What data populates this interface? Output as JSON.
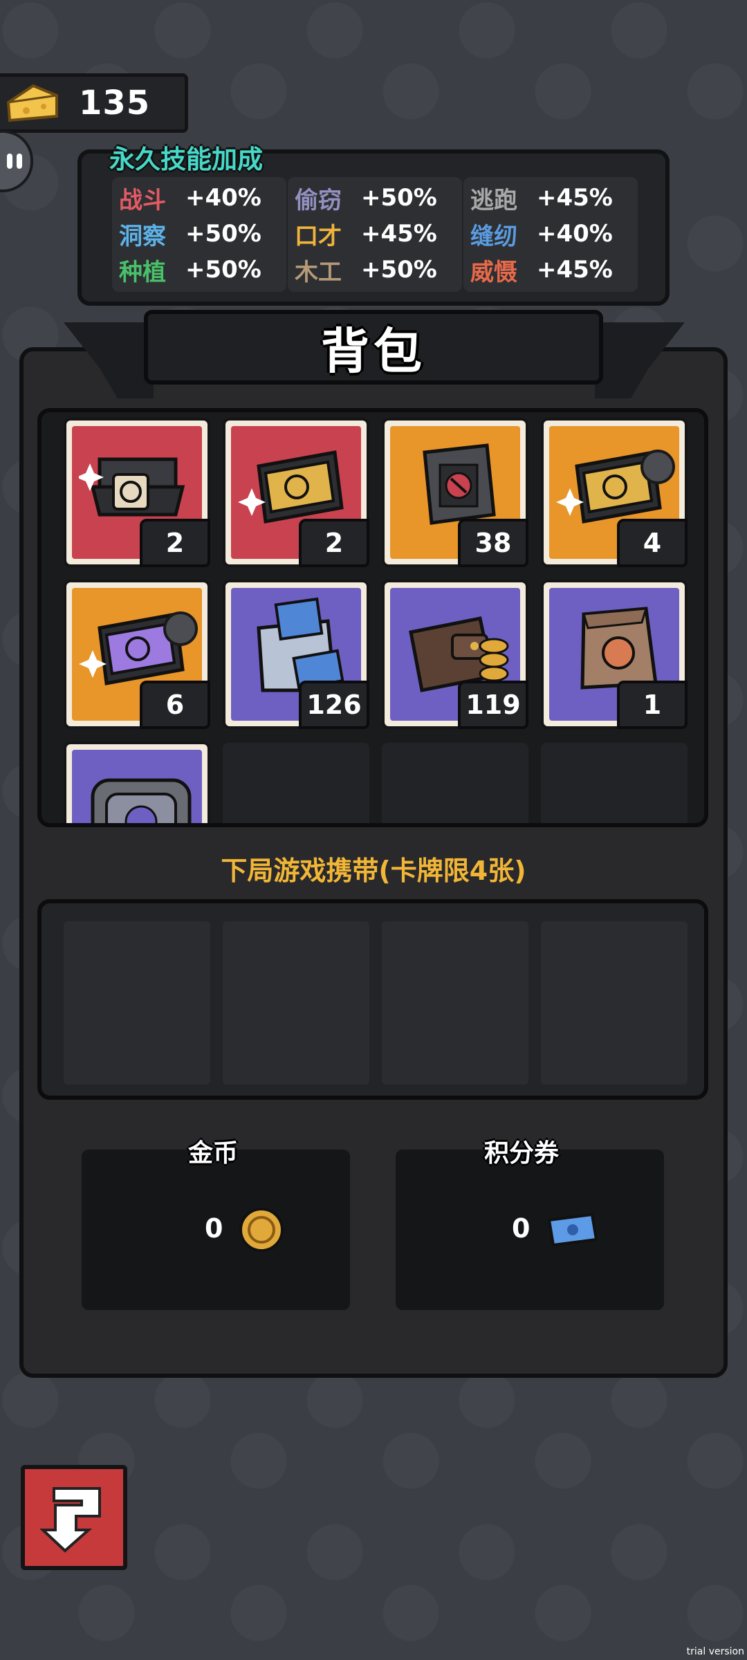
{
  "header": {
    "cheese_count": "135"
  },
  "skills": {
    "title": "永久技能加成",
    "columns": [
      [
        {
          "name": "战斗",
          "value": "+40%",
          "color": "#e35b64"
        },
        {
          "name": "洞察",
          "value": "+50%",
          "color": "#5db2e8"
        },
        {
          "name": "种植",
          "value": "+50%",
          "color": "#49c06a"
        }
      ],
      [
        {
          "name": "偷窃",
          "value": "+50%",
          "color": "#9490c0"
        },
        {
          "name": "口才",
          "value": "+45%",
          "color": "#f0b43c"
        },
        {
          "name": "木工",
          "value": "+50%",
          "color": "#b59a78"
        }
      ],
      [
        {
          "name": "逃跑",
          "value": "+45%",
          "color": "#a9a9a9"
        },
        {
          "name": "缝纫",
          "value": "+40%",
          "color": "#5b9be0"
        },
        {
          "name": "威慑",
          "value": "+45%",
          "color": "#e8694a"
        }
      ]
    ]
  },
  "backpack": {
    "title": "背包",
    "items": [
      {
        "icon": "open-card-box-icon",
        "bg": "red",
        "qty": "2"
      },
      {
        "icon": "card-pack-icon",
        "bg": "red",
        "qty": "2"
      },
      {
        "icon": "sealed-card-pack-icon",
        "bg": "orange",
        "qty": "38"
      },
      {
        "icon": "card-pack-icon",
        "bg": "orange",
        "qty": "4",
        "puzzle": true
      },
      {
        "icon": "purple-card-pack-icon",
        "bg": "orange",
        "qty": "6",
        "puzzle": true
      },
      {
        "icon": "ticket-bag-icon",
        "bg": "purple",
        "qty": "126"
      },
      {
        "icon": "wallet-icon",
        "bg": "purple",
        "qty": "119"
      },
      {
        "icon": "paper-bag-icon",
        "bg": "purple",
        "qty": "1"
      },
      {
        "icon": "cheese-tin-icon",
        "bg": "purple",
        "qty": ""
      }
    ]
  },
  "carry": {
    "label": "下局游戏携带(卡牌限4张)"
  },
  "currency": {
    "gold_label": "金币",
    "gold_value": "0",
    "points_label": "积分券",
    "points_value": "0"
  },
  "footer": {
    "watermark": "trial version"
  }
}
